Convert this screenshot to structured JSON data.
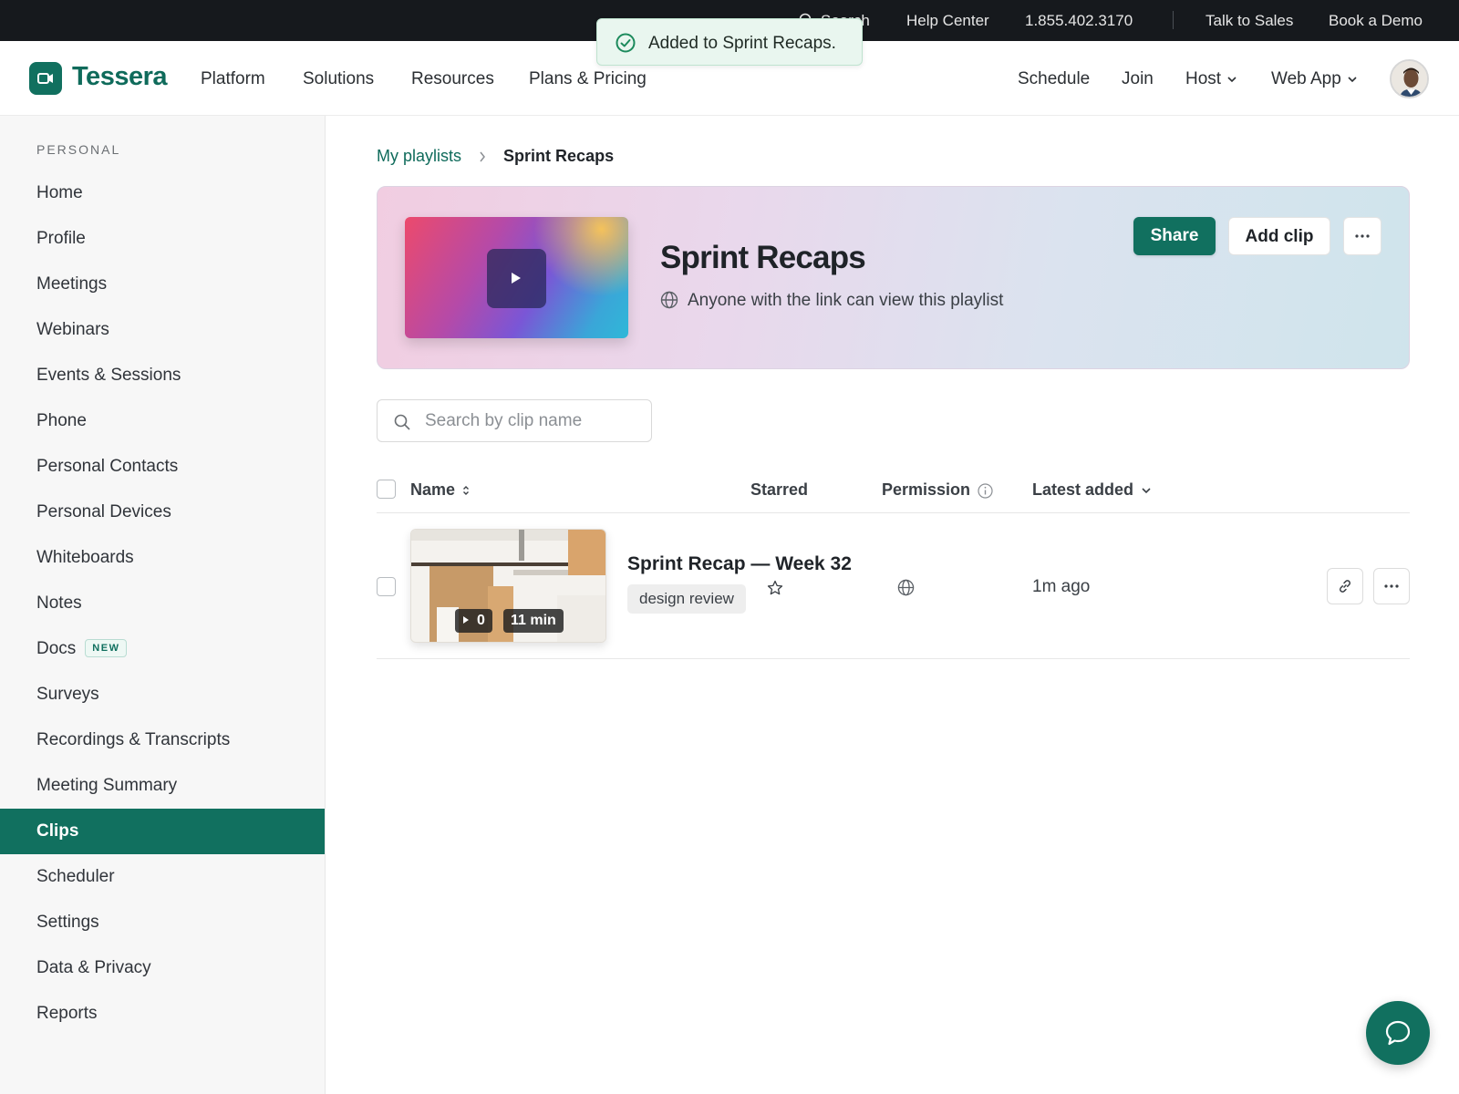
{
  "utility_bar": {
    "search_label": "Search",
    "help_center": "Help Center",
    "phone": "1.855.402.3170",
    "talk_to_sales": "Talk to Sales",
    "book_demo": "Book a Demo"
  },
  "toast": {
    "message": "Added to Sprint Recaps.",
    "icon": "check-circle-icon"
  },
  "nav": {
    "brand": "Tessera",
    "links": [
      "Platform",
      "Solutions",
      "Resources",
      "Plans & Pricing"
    ],
    "right": {
      "schedule": "Schedule",
      "join": "Join",
      "host": "Host",
      "web_app": "Web App"
    }
  },
  "sidebar": {
    "section": "PERSONAL",
    "items": [
      "Home",
      "Profile",
      "Meetings",
      "Webinars",
      "Events & Sessions",
      "Phone",
      "Personal Contacts",
      "Personal Devices",
      "Whiteboards",
      "Notes",
      "Docs",
      "Surveys",
      "Recordings & Transcripts",
      "Meeting Summary",
      "Clips",
      "Scheduler",
      "Settings",
      "Data & Privacy",
      "Reports"
    ],
    "docs_badge": "NEW",
    "active": "Clips"
  },
  "breadcrumb": {
    "parent": "My playlists",
    "current": "Sprint Recaps"
  },
  "playlist": {
    "title": "Sprint Recaps",
    "visibility": "Anyone with the link can view this playlist",
    "share_label": "Share",
    "add_clip_label": "Add clip"
  },
  "search": {
    "placeholder": "Search by clip name",
    "value": ""
  },
  "table": {
    "headers": {
      "name": "Name",
      "starred": "Starred",
      "permission": "Permission",
      "latest": "Latest added"
    },
    "rows": [
      {
        "title": "Sprint Recap — Week 32",
        "tag": "design review",
        "views": "0",
        "duration": "11 min",
        "added": "1m ago",
        "starred": false,
        "permission_icon": "globe-icon"
      }
    ]
  },
  "colors": {
    "brand": "#11705f",
    "topbar": "#16191d",
    "toast_bg": "#e9f6ef"
  }
}
